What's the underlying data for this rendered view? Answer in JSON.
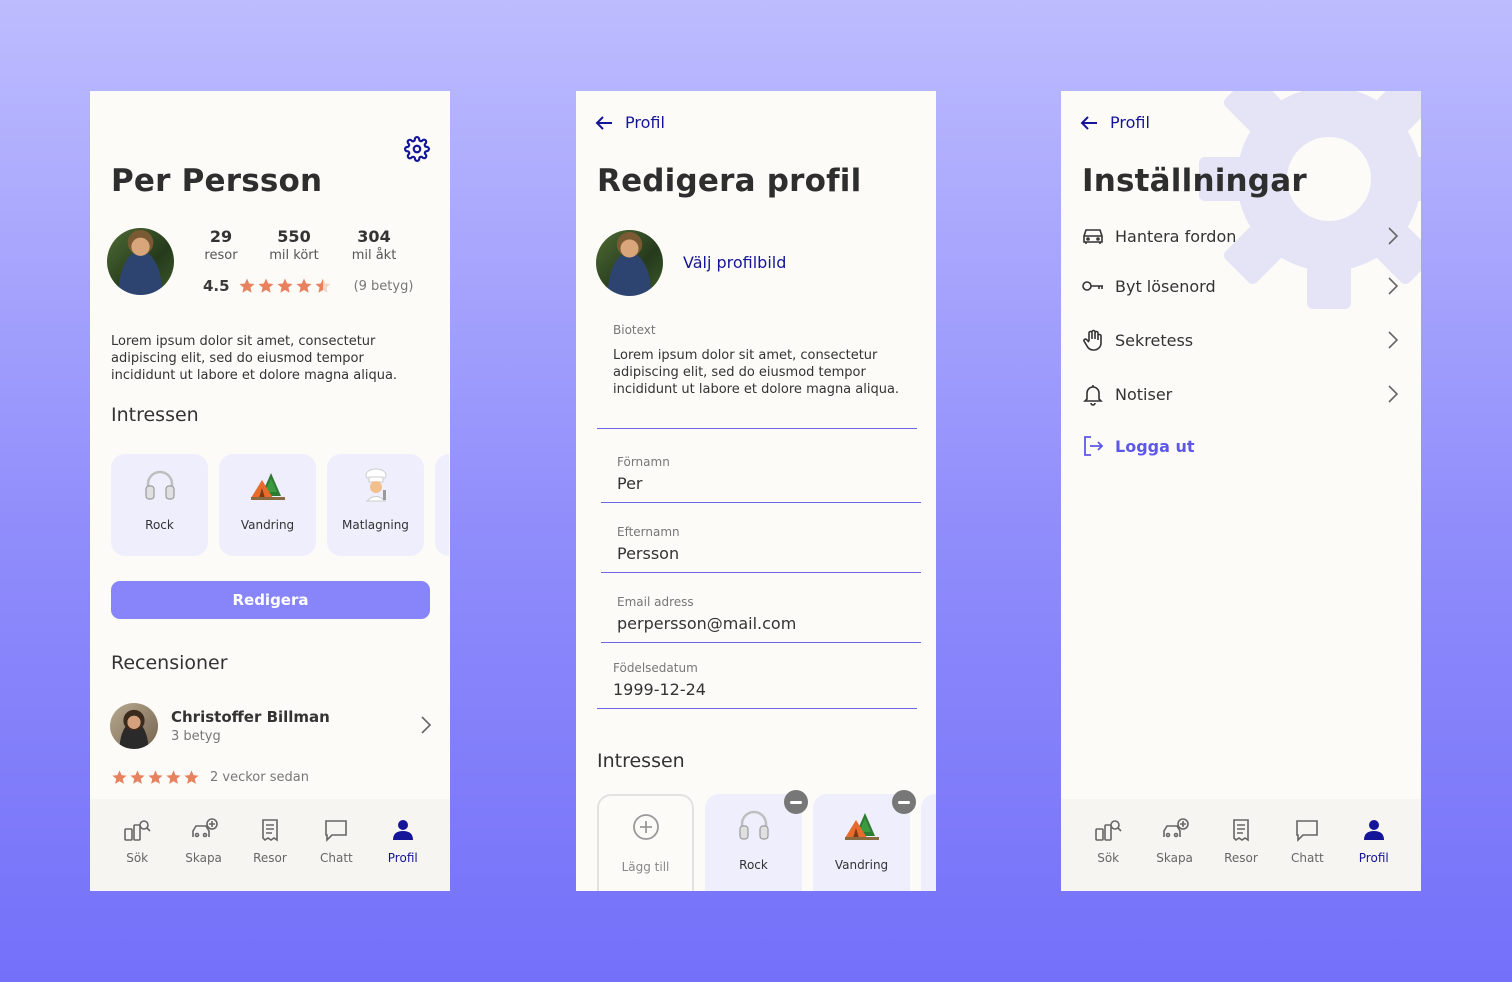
{
  "profile": {
    "name": "Per Persson",
    "stats": [
      {
        "value": "29",
        "label": "resor"
      },
      {
        "value": "550",
        "label": "mil kört"
      },
      {
        "value": "304",
        "label": "mil åkt"
      }
    ],
    "rating_value": "4.5",
    "rating_stars": 4.5,
    "rating_count": "(9 betyg)",
    "bio": "Lorem ipsum dolor sit amet, consectetur adipiscing elit, sed do eiusmod tempor incididunt ut labore et dolore magna aliqua.",
    "interests_title": "Intressen",
    "interests": [
      {
        "label": "Rock",
        "icon": "headphones-icon"
      },
      {
        "label": "Vandring",
        "icon": "tent-icon"
      },
      {
        "label": "Matlagning",
        "icon": "chef-icon"
      }
    ],
    "edit_button": "Redigera",
    "reviews_title": "Recensioner",
    "review": {
      "name": "Christoffer Billman",
      "sub": "3 betyg",
      "stars": 5,
      "ago": "2 veckor sedan"
    }
  },
  "edit": {
    "back_label": "Profil",
    "title": "Redigera profil",
    "choose_picture": "Välj profilbild",
    "fields": {
      "bio_label": "Biotext",
      "bio_value": "Lorem ipsum dolor sit amet, consectetur adipiscing elit, sed do eiusmod tempor incididunt ut labore et dolore magna aliqua.",
      "firstname_label": "Förnamn",
      "firstname_value": "Per",
      "lastname_label": "Efternamn",
      "lastname_value": "Persson",
      "email_label": "Email adress",
      "email_value": "perpersson@mail.com",
      "birth_label": "Födelsedatum",
      "birth_value": "1999-12-24"
    },
    "interests_title": "Intressen",
    "add_label": "Lägg till",
    "interests": [
      {
        "label": "Rock",
        "icon": "headphones-icon"
      },
      {
        "label": "Vandring",
        "icon": "tent-icon"
      }
    ]
  },
  "settings": {
    "back_label": "Profil",
    "title": "Inställningar",
    "items": [
      {
        "label": "Hantera fordon",
        "icon": "car-icon"
      },
      {
        "label": "Byt lösenord",
        "icon": "key-icon"
      },
      {
        "label": "Sekretess",
        "icon": "hand-icon"
      },
      {
        "label": "Notiser",
        "icon": "bell-icon"
      }
    ],
    "logout": "Logga ut"
  },
  "nav": {
    "items": [
      "Sök",
      "Skapa",
      "Resor",
      "Chatt",
      "Profil"
    ],
    "active": "Profil"
  },
  "colors": {
    "accent": "#151599",
    "primary_button": "#8885fb",
    "chip_bg": "#eeeefd",
    "star": "#e8825e",
    "logout": "#5d58ea"
  }
}
